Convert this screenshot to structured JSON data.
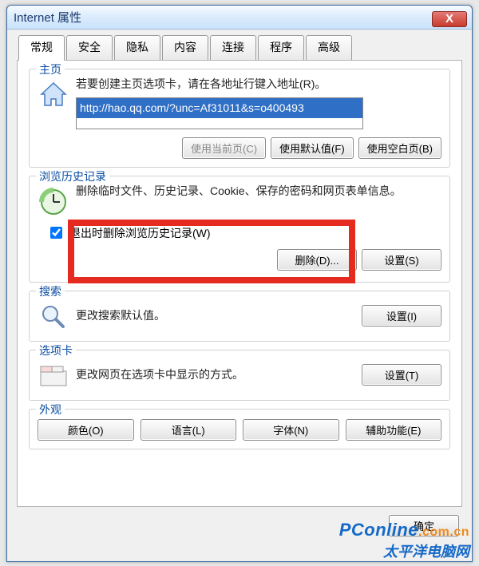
{
  "window": {
    "title": "Internet 属性",
    "close": "X"
  },
  "tabs": [
    "常规",
    "安全",
    "隐私",
    "内容",
    "连接",
    "程序",
    "高级"
  ],
  "active_tab": 0,
  "home": {
    "legend": "主页",
    "desc": "若要创建主页选项卡，请在各地址行键入地址(R)。",
    "url": "http://hao.qq.com/?unc=Af31011&s=o400493",
    "btn_current": "使用当前页(C)",
    "btn_default": "使用默认值(F)",
    "btn_blank": "使用空白页(B)"
  },
  "history": {
    "legend": "浏览历史记录",
    "desc": "删除临时文件、历史记录、Cookie、保存的密码和网页表单信息。",
    "check_label": "退出时删除浏览历史记录(W)",
    "checked": true,
    "btn_delete": "删除(D)...",
    "btn_settings": "设置(S)"
  },
  "search": {
    "legend": "搜索",
    "desc": "更改搜索默认值。",
    "btn_settings": "设置(I)"
  },
  "tabcard": {
    "legend": "选项卡",
    "desc": "更改网页在选项卡中显示的方式。",
    "btn_settings": "设置(T)"
  },
  "appearance": {
    "legend": "外观",
    "btn_color": "颜色(O)",
    "btn_lang": "语言(L)",
    "btn_font": "字体(N)",
    "btn_access": "辅助功能(E)"
  },
  "footer": {
    "ok": "确定"
  },
  "watermark": {
    "line1a": "PConline",
    "line1b": ".com.cn",
    "line2": "太平洋电脑网"
  }
}
